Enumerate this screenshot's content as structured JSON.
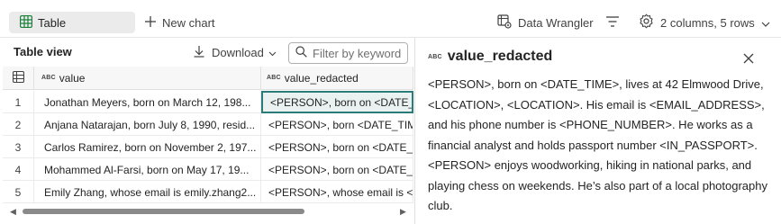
{
  "toolbar": {
    "table_tab": "Table",
    "new_chart": "New chart",
    "data_wrangler": "Data Wrangler",
    "summary": "2 columns, 5 rows"
  },
  "left": {
    "title": "Table view",
    "download": "Download",
    "filter_placeholder": "Filter by keyword",
    "headers": {
      "type_tag": "ABC",
      "col1": "value",
      "col2": "value_redacted"
    },
    "rows": [
      {
        "num": "1",
        "value": "Jonathan Meyers, born on March 12, 198...",
        "redacted": "<PERSON>, born on <DATE_TI"
      },
      {
        "num": "2",
        "value": "Anjana Natarajan, born July 8, 1990, resid...",
        "redacted": "<PERSON>, born <DATE_TIME"
      },
      {
        "num": "3",
        "value": "Carlos Ramirez, born on November 2, 197...",
        "redacted": "<PERSON>, born on <DATE_TI"
      },
      {
        "num": "4",
        "value": "Mohammed Al-Farsi, born on May 17, 19...",
        "redacted": "<PERSON>, born on <DATE_TI"
      },
      {
        "num": "5",
        "value": "Emily Zhang, whose email is emily.zhang2...",
        "redacted": "<PERSON>, whose email is <E"
      }
    ]
  },
  "right": {
    "type_tag": "ABC",
    "title": "value_redacted",
    "text": "<PERSON>, born on <DATE_TIME>, lives at 42 Elmwood Drive, <LOCATION>, <LOCATION>. His email is <EMAIL_ADDRESS>, and his phone number is <PHONE_NUMBER>. He works as a financial analyst and holds passport number <IN_PASSPORT>. <PERSON> enjoys woodworking, hiking in national parks, and playing chess on weekends. He’s also part of a local photography club."
  },
  "colors": {
    "accent": "#2a7b7a",
    "table_icon": "#1a7f37"
  }
}
